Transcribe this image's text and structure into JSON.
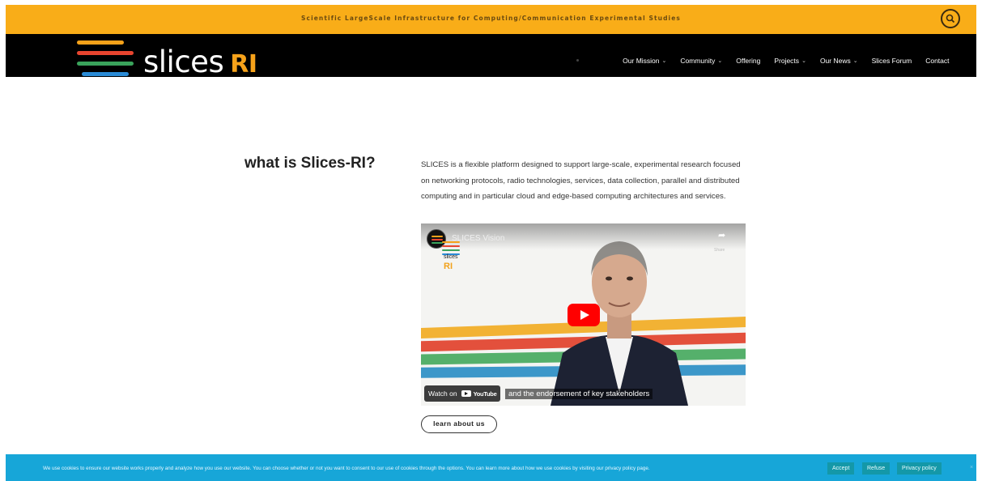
{
  "top_bar": {
    "tagline": "Scientific LargeScale Infrastructure for Computing/Communication Experimental Studies",
    "bg_color": "#f9ad18"
  },
  "header": {
    "logo": {
      "text": "slices",
      "suffix": "RI",
      "bar_colors": [
        "#f6a21a",
        "#e8452f",
        "#3aa35b",
        "#2a8bd6"
      ]
    },
    "nav": [
      {
        "label": "Our Mission",
        "chevron": "⌄"
      },
      {
        "label": "Community",
        "chevron": "⌄"
      },
      {
        "label": "Offering",
        "chevron": ""
      },
      {
        "label": "Projects",
        "chevron": "⌄"
      },
      {
        "label": "Our News",
        "chevron": "⌄"
      },
      {
        "label": "Slices Forum",
        "chevron": ""
      },
      {
        "label": "Contact",
        "chevron": ""
      }
    ]
  },
  "main": {
    "heading": "what is Slices-RI?",
    "description": "SLICES is a flexible platform designed to support large-scale, experimental research focused on networking protocols, radio technologies, services, data collection, parallel and distributed computing and in particular cloud and edge-based computing architectures and services.",
    "video": {
      "title": "SLICES Vision",
      "brand_small": "slices",
      "brand_ri": "RI",
      "watch_on": "Watch on",
      "youtube": "YouTube",
      "caption": "and the endorsement of key stakeholders",
      "share_label": "Share",
      "stripe_colors": [
        "#f2b234",
        "#e3503c",
        "#55b06b",
        "#3c97c9"
      ]
    },
    "learn_button": "learn about us"
  },
  "cookie_banner": {
    "text": "We use cookies to ensure our website works properly and analyze how you use our website. You can choose whether or not you want to consent to our use of cookies through the options. You can learn more about how we use cookies by visiting our privacy policy page.",
    "accept": "Accept",
    "refuse": "Refuse",
    "privacy": "Privacy policy",
    "close": "×",
    "bg_color": "#17a6d8"
  },
  "icons": {
    "search": "search-icon",
    "share": "share-icon",
    "play": "play-icon"
  }
}
